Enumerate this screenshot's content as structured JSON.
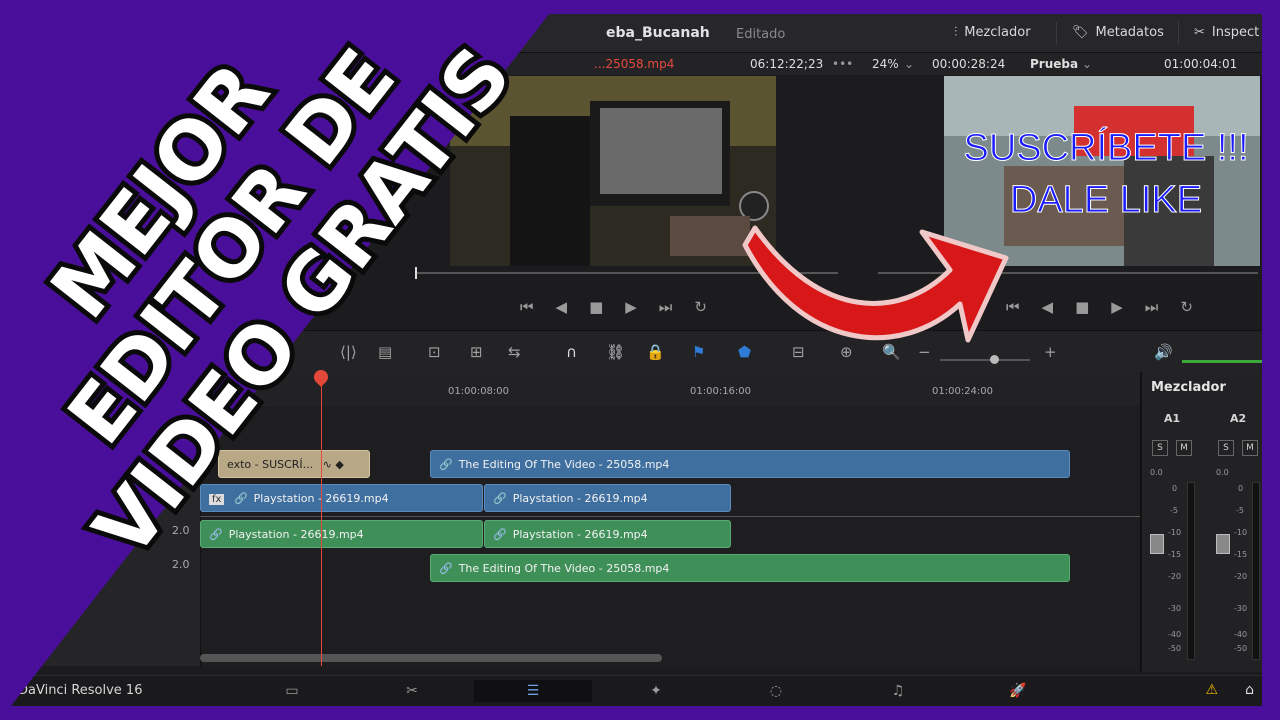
{
  "header": {
    "project_name": "eba_Bucanah",
    "status": "Editado",
    "mixer_label": "Mezclador",
    "metadata_label": "Metadatos",
    "inspector_label": "Inspect"
  },
  "source_viewer": {
    "clip_name": "...25058.mp4",
    "timecode": "06:12:22;23",
    "more": "•••"
  },
  "timeline_viewer": {
    "zoom": "24%",
    "duration": "00:00:28:24",
    "timeline_name": "Prueba",
    "timecode": "01:00:04:01",
    "overlay_line1": "SUSCRÍBETE !!!",
    "overlay_line2": "DALE LIKE"
  },
  "ruler": {
    "marks": [
      "01:00:08:00",
      "01:00:16:00",
      "01:00:24:00"
    ]
  },
  "tracks": {
    "text_clip": "exto - SUSCRÍ...",
    "v2_clip": "The Editing Of The Video - 25058.mp4",
    "v1_clip_a": "Playstation - 26619.mp4",
    "v1_clip_b": "Playstation - 26619.mp4",
    "v1_fx": "fx",
    "a1_clip_a": "Playstation - 26619.mp4",
    "a1_clip_b": "Playstation - 26619.mp4",
    "a2_clip": "The Editing Of The Video - 25058.mp4",
    "a1_level": "2.0",
    "a2_level": "2.0"
  },
  "mixer": {
    "title": "Mezclador",
    "channels": [
      "A1",
      "A2"
    ],
    "solo": "S",
    "mute": "M",
    "level_readout": "0.0",
    "scale": [
      "0",
      "-5",
      "-10",
      "-15",
      "-20",
      "-30",
      "-40",
      "-50"
    ]
  },
  "bottom": {
    "brand": "DaVinci Resolve 16",
    "warning_icon": "⚠",
    "home_icon": "⌂"
  },
  "thumbnail": {
    "line1": "MEJOR",
    "line2": "EDITOR DE",
    "line3": "VIDEO GRATIS"
  },
  "colors": {
    "banner_bg": "#4a0f9a",
    "video_clip": "#3f6f9f",
    "audio_clip": "#3f8f59",
    "title_clip": "#b9a886",
    "playhead": "#e3483a",
    "arrow": "#d81818"
  }
}
